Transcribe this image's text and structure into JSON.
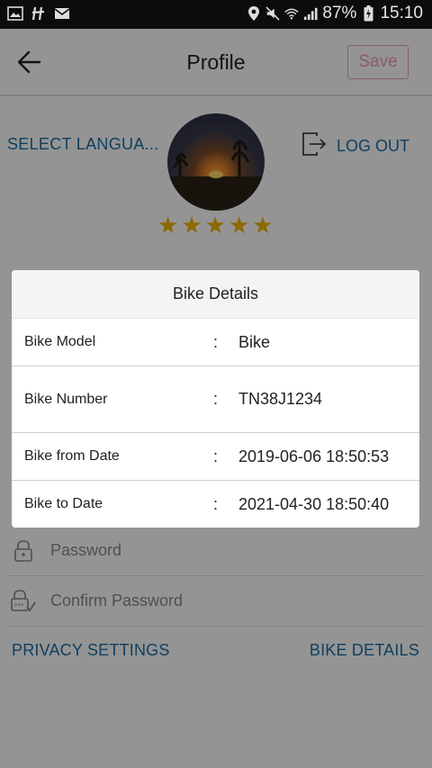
{
  "status_bar": {
    "battery": "87%",
    "time": "15:10",
    "icons": [
      "gallery-icon",
      "hike-icon",
      "email-icon",
      "location-icon",
      "mute-icon",
      "wifi-icon",
      "signal-icon",
      "battery-icon"
    ]
  },
  "header": {
    "title": "Profile",
    "save_label": "Save",
    "back_icon": "back-arrow-icon"
  },
  "profile": {
    "select_language": "SELECT LANGUA...",
    "log_out": "LOG OUT",
    "rating": 5,
    "stars": [
      "★",
      "★",
      "★",
      "★",
      "★"
    ],
    "fields": [
      {
        "placeholder": "Password",
        "icon": "lock-icon"
      },
      {
        "placeholder": "Confirm Password",
        "icon": "lock-check-icon"
      }
    ],
    "privacy_settings": "PRIVACY SETTINGS",
    "bike_details_link": "BIKE DETAILS"
  },
  "dialog": {
    "title": "Bike Details",
    "colon": ":",
    "rows": [
      {
        "label": "Bike Model",
        "value": "Bike"
      },
      {
        "label": "Bike Number",
        "value": "TN38J1234"
      },
      {
        "label": "Bike from Date",
        "value": "2019-06-06 18:50:53"
      },
      {
        "label": "Bike to Date",
        "value": "2021-04-30 18:50:40"
      }
    ]
  },
  "colors": {
    "link": "#1d6fa5",
    "save_text": "#f29bb0",
    "save_border": "#e8a6b6",
    "star": "#f5b400"
  }
}
